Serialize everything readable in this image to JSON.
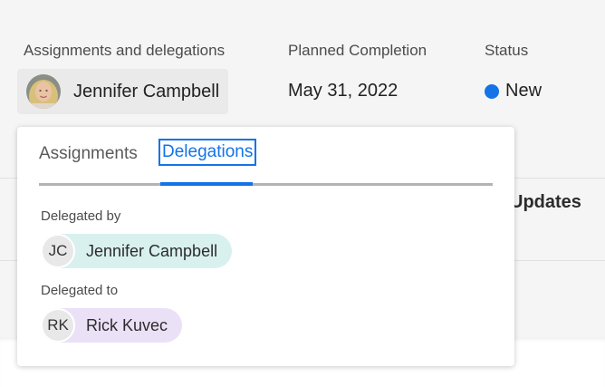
{
  "table": {
    "headers": {
      "assignments": "Assignments and delegations",
      "planned_completion": "Planned Completion",
      "status": "Status"
    },
    "row": {
      "assignee": "Jennifer Campbell",
      "planned_completion": "May 31, 2022",
      "status": "New",
      "status_color": "#1473e6"
    },
    "background_column_fragment": "Updates"
  },
  "popover": {
    "tabs": [
      {
        "label": "Assignments",
        "active": false
      },
      {
        "label": "Delegations",
        "active": true
      }
    ],
    "delegated_by": {
      "label": "Delegated by",
      "initials": "JC",
      "name": "Jennifer Campbell",
      "pill_color": "#d9f1ee"
    },
    "delegated_to": {
      "label": "Delegated to",
      "initials": "RK",
      "name": "Rick Kuvec",
      "pill_color": "#ebe1f7"
    }
  },
  "colors": {
    "accent": "#1473e6"
  }
}
